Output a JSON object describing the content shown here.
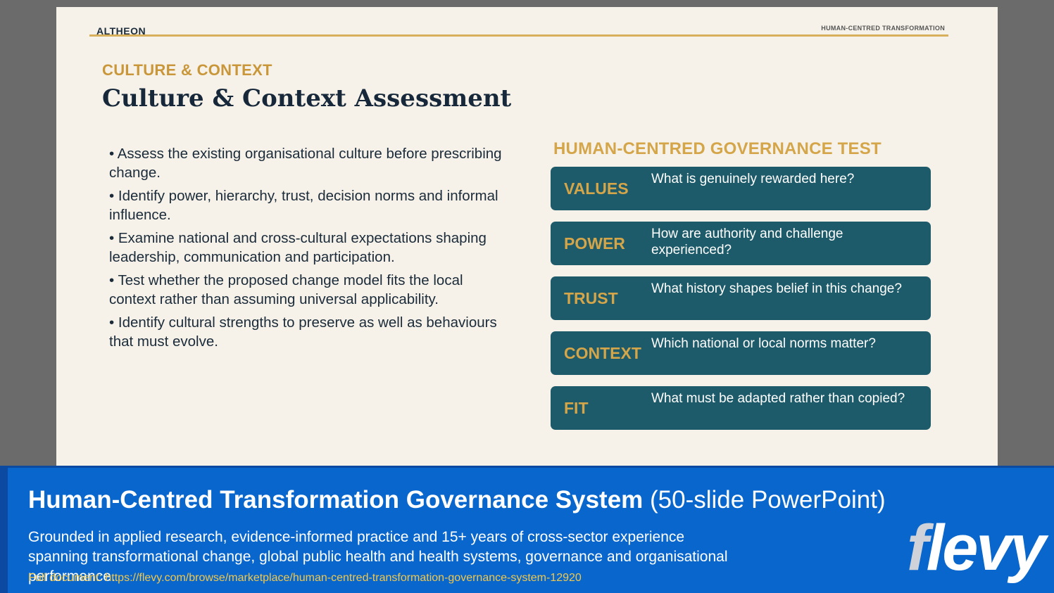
{
  "slide": {
    "brand": "ALTHEON",
    "header_tag": "HUMAN-CENTRED TRANSFORMATION",
    "kicker": "CULTURE & CONTEXT",
    "title": "Culture & Context Assessment",
    "bullets": [
      "•  Assess the existing organisational culture before prescribing change.",
      "•  Identify power, hierarchy, trust, decision norms and informal influence.",
      "•  Examine national and cross-cultural expectations shaping leadership, communication and participation.",
      "•  Test whether the proposed change model fits the local context rather than assuming universal applicability.",
      "•  Identify cultural strengths to preserve as well as behaviours that must evolve."
    ],
    "test_title": "HUMAN-CENTRED GOVERNANCE TEST",
    "cards": [
      {
        "label": "VALUES",
        "question": "What is genuinely rewarded here?"
      },
      {
        "label": "POWER",
        "question": "How are authority and challenge experienced?"
      },
      {
        "label": "TRUST",
        "question": "What history shapes belief in this change?"
      },
      {
        "label": "CONTEXT",
        "question": "Which national or local norms matter?"
      },
      {
        "label": "FIT",
        "question": "What must be adapted rather than copied?"
      }
    ]
  },
  "banner": {
    "title_bold": "Human-Centred Transformation Governance System",
    "title_light": "(50-slide PowerPoint)",
    "description": "Grounded in applied research, evidence-informed practice and 15+ years of cross-sector experience spanning transformational change, global public health and health systems, governance and organisational performance.",
    "link": "Full document: https://flevy.com/browse/marketplace/human-centred-transformation-governance-system-12920",
    "logo_text": "flevy"
  },
  "colors": {
    "slide_bg": "#f6f2e9",
    "accent_gold": "#d4a549",
    "card_teal": "#1d5b6a",
    "banner_blue": "#0866cc",
    "link_yellow": "#f2c84b"
  }
}
